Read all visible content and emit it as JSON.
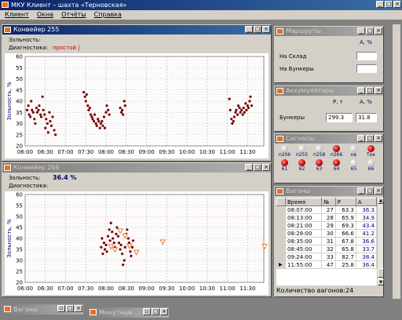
{
  "app": {
    "title": "МКУ Клиент – шахта «Терновская»"
  },
  "menu": [
    "Клиент",
    "Окна",
    "Отчёты",
    "Справка"
  ],
  "conveyor255": {
    "title": "Конвейер 255",
    "ash_label": "Зольность:",
    "ash_value": "",
    "diag_label": "Диагностика:",
    "diag_value": "простой |",
    "diag_color": "#cc0000"
  },
  "conveyor266": {
    "title": "Конвейер 266",
    "ash_label": "Зольность:",
    "ash_value": "36.4 %",
    "diag_label": "Диагностика:",
    "diag_value": ""
  },
  "routes": {
    "title": "Маршруты",
    "unit": "А, %",
    "rows": [
      "На Склад",
      "На Бункеры"
    ]
  },
  "accumulators": {
    "title": "Аккумуляторы",
    "col1": "Р, т",
    "col2": "А, %",
    "row_label": "Бункеры",
    "p": "299.3",
    "a": "31.8"
  },
  "signals": {
    "title": "Сигналы",
    "items": [
      {
        "label": "п206",
        "on": false
      },
      {
        "label": "п255",
        "on": false
      },
      {
        "label": "п258",
        "on": false
      },
      {
        "label": "п266",
        "on": true
      },
      {
        "label": "кв",
        "on": false
      },
      {
        "label": "Ток",
        "on": true
      },
      {
        "label": "61",
        "on": true
      },
      {
        "label": "62",
        "on": true
      },
      {
        "label": "63",
        "on": true
      },
      {
        "label": "64",
        "on": true
      },
      {
        "label": "65",
        "on": false
      },
      {
        "label": "66",
        "on": false
      }
    ]
  },
  "wagons": {
    "title": "Вагоны",
    "columns": [
      "Время",
      "№",
      "Р",
      "А"
    ],
    "rows": [
      [
        "08:07:00",
        "27",
        "63.3",
        "36.3"
      ],
      [
        "08:13:00",
        "28",
        "65.9",
        "34.9"
      ],
      [
        "08:21:00",
        "29",
        "69.3",
        "43.4"
      ],
      [
        "08:28:00",
        "30",
        "66.6",
        "41.2"
      ],
      [
        "08:35:00",
        "31",
        "67.8",
        "36.6"
      ],
      [
        "08:45:00",
        "32",
        "65.8",
        "33.7"
      ],
      [
        "09:24:00",
        "33",
        "82.7",
        "38.4"
      ],
      [
        "11:55:00",
        "47",
        "25.8",
        "36.4"
      ]
    ],
    "count_label": "Количество вагонов:",
    "count_value": "24"
  },
  "taskbar": [
    {
      "title": "Вагоны"
    },
    {
      "title": "Минутные ..."
    }
  ],
  "chart_data": [
    {
      "type": "scatter",
      "title": "Конвейер 255",
      "ylabel": "Зольность, %",
      "ylim": [
        20,
        60
      ],
      "yticks": [
        20,
        25,
        30,
        35,
        40,
        45,
        50,
        55,
        60
      ],
      "xticks": [
        "06:00",
        "06:30",
        "07:00",
        "07:30",
        "08:00",
        "08:30",
        "09:00",
        "09:30",
        "10:00",
        "10:30",
        "11:00",
        "11:30"
      ],
      "xlim_hours": [
        6.0,
        11.9
      ],
      "grid": true,
      "series": [
        {
          "marker": "dot",
          "color": "#7a0000",
          "points": [
            [
              6.05,
              36
            ],
            [
              6.08,
              38
            ],
            [
              6.1,
              34
            ],
            [
              6.13,
              33
            ],
            [
              6.15,
              40
            ],
            [
              6.17,
              36
            ],
            [
              6.2,
              35
            ],
            [
              6.23,
              32
            ],
            [
              6.25,
              30
            ],
            [
              6.28,
              37
            ],
            [
              6.3,
              35
            ],
            [
              6.33,
              36
            ],
            [
              6.35,
              38
            ],
            [
              6.38,
              34
            ],
            [
              6.4,
              33
            ],
            [
              6.43,
              42
            ],
            [
              6.45,
              36
            ],
            [
              6.48,
              34
            ],
            [
              6.5,
              28
            ],
            [
              6.52,
              32
            ],
            [
              6.55,
              30
            ],
            [
              6.57,
              26
            ],
            [
              6.6,
              35
            ],
            [
              6.62,
              31
            ],
            [
              6.65,
              29
            ],
            [
              6.68,
              33
            ],
            [
              6.72,
              27
            ],
            [
              6.75,
              25
            ],
            [
              7.45,
              44
            ],
            [
              7.48,
              42
            ],
            [
              7.5,
              40
            ],
            [
              7.52,
              43
            ],
            [
              7.55,
              38
            ],
            [
              7.57,
              36
            ],
            [
              7.6,
              37
            ],
            [
              7.62,
              34
            ],
            [
              7.65,
              33
            ],
            [
              7.67,
              32
            ],
            [
              7.7,
              31
            ],
            [
              7.72,
              34
            ],
            [
              7.75,
              30
            ],
            [
              7.77,
              29
            ],
            [
              7.8,
              32
            ],
            [
              7.82,
              31
            ],
            [
              7.85,
              28
            ],
            [
              7.87,
              30
            ],
            [
              7.9,
              31
            ],
            [
              7.92,
              29
            ],
            [
              7.95,
              33
            ],
            [
              7.97,
              28
            ],
            [
              8.0,
              35
            ],
            [
              8.02,
              38
            ],
            [
              8.05,
              36
            ],
            [
              8.08,
              34
            ],
            [
              8.35,
              37
            ],
            [
              8.38,
              35
            ],
            [
              8.4,
              36
            ],
            [
              8.42,
              34
            ],
            [
              8.45,
              40
            ],
            [
              8.47,
              38
            ],
            [
              11.05,
              41
            ],
            [
              11.07,
              36
            ],
            [
              11.1,
              32
            ],
            [
              11.12,
              30
            ],
            [
              11.15,
              31
            ],
            [
              11.17,
              33
            ],
            [
              11.2,
              35
            ],
            [
              11.22,
              36
            ],
            [
              11.25,
              34
            ],
            [
              11.27,
              38
            ],
            [
              11.3,
              37
            ],
            [
              11.32,
              35
            ],
            [
              11.35,
              36
            ],
            [
              11.38,
              34
            ],
            [
              11.4,
              37
            ],
            [
              11.42,
              35
            ],
            [
              11.45,
              39
            ],
            [
              11.47,
              36
            ],
            [
              11.5,
              38
            ],
            [
              11.52,
              37
            ],
            [
              11.55,
              40
            ],
            [
              11.57,
              42
            ],
            [
              11.6,
              38
            ]
          ]
        }
      ]
    },
    {
      "type": "scatter",
      "title": "Конвейер 266",
      "ylabel": "Зольность, %",
      "ylim": [
        20,
        60
      ],
      "yticks": [
        20,
        25,
        30,
        35,
        40,
        45,
        50,
        55,
        60
      ],
      "xticks": [
        "06:00",
        "06:30",
        "07:00",
        "07:30",
        "08:00",
        "08:30",
        "09:00",
        "09:30",
        "10:00",
        "10:30",
        "11:00",
        "11:30"
      ],
      "xlim_hours": [
        6.0,
        11.9
      ],
      "grid": true,
      "series": [
        {
          "marker": "dot",
          "color": "#7a0000",
          "points": [
            [
              7.88,
              36
            ],
            [
              7.9,
              40
            ],
            [
              7.92,
              33
            ],
            [
              7.95,
              38
            ],
            [
              7.97,
              35
            ],
            [
              8.0,
              37
            ],
            [
              8.02,
              34
            ],
            [
              8.05,
              41
            ],
            [
              8.08,
              44
            ],
            [
              8.1,
              39
            ],
            [
              8.12,
              47
            ],
            [
              8.15,
              43
            ],
            [
              8.17,
              40
            ],
            [
              8.2,
              38
            ],
            [
              8.22,
              36
            ],
            [
              8.25,
              42
            ],
            [
              8.27,
              45
            ],
            [
              8.3,
              41
            ],
            [
              8.32,
              38
            ],
            [
              8.35,
              35
            ],
            [
              8.37,
              37
            ],
            [
              8.4,
              33
            ],
            [
              8.42,
              28
            ],
            [
              8.45,
              30
            ],
            [
              8.47,
              36
            ],
            [
              8.5,
              42
            ],
            [
              8.52,
              44
            ],
            [
              8.55,
              40
            ],
            [
              8.57,
              38
            ],
            [
              8.6,
              34
            ],
            [
              8.62,
              32
            ],
            [
              8.65,
              36
            ],
            [
              8.67,
              39
            ]
          ]
        },
        {
          "marker": "triangle",
          "color": "#e07020",
          "points": [
            [
              8.12,
              36.3
            ],
            [
              8.22,
              34.9
            ],
            [
              8.35,
              43.4
            ],
            [
              8.47,
              41.2
            ],
            [
              8.58,
              36.6
            ],
            [
              8.75,
              33.7
            ],
            [
              9.4,
              38.4
            ],
            [
              11.92,
              36.4
            ]
          ]
        }
      ]
    }
  ]
}
